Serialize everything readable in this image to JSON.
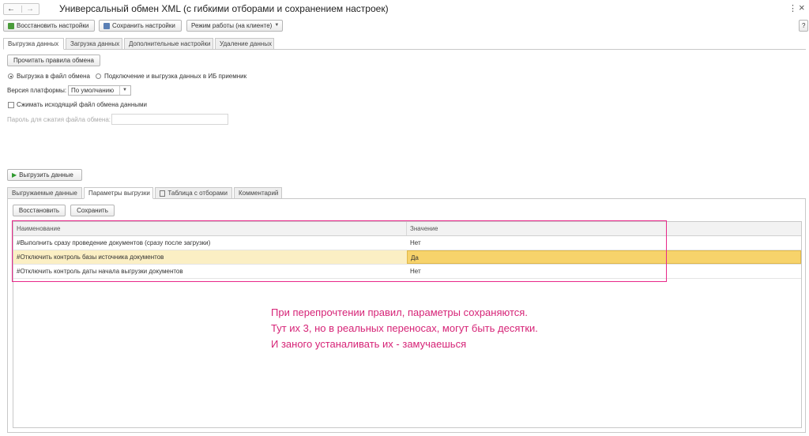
{
  "window": {
    "title": "Универсальный обмен XML (с гибкими отборами и сохранением настроек)",
    "help_label": "?",
    "more_glyph": "⋮",
    "close_glyph": "×"
  },
  "nav": {
    "back_glyph": "←",
    "forward_glyph": "→"
  },
  "toolbar": {
    "restore_settings": "Восстановить настройки",
    "save_settings": "Сохранить настройки",
    "mode": "Режим работы (на клиенте)"
  },
  "main_tabs": [
    "Выгрузка данных",
    "Загрузка данных",
    "Дополнительные настройки",
    "Удаление данных"
  ],
  "export": {
    "read_rules_button": "Прочитать правила обмена",
    "radio_file": "Выгрузка в файл обмена",
    "radio_connect": "Подключение и выгрузка данных в ИБ приемник",
    "platform_label": "Версия платформы:",
    "platform_value": "По умолчанию",
    "compress_label": "Сжимать исходящий файл обмена данными",
    "password_label": "Пароль для сжатия файла обмена:",
    "password_value": "",
    "run_button": "Выгрузить данные"
  },
  "sub_tabs": [
    "Выгружаемые данные",
    "Параметры выгрузки",
    "Таблица с отборами",
    "Комментарий"
  ],
  "params": {
    "restore_button": "Восстановить",
    "save_button": "Сохранить",
    "columns": {
      "name": "Наименование",
      "value": "Значение"
    },
    "rows": [
      {
        "name": "#Выполнить сразу проведение документов (сразу после загрузки)",
        "value": "Нет"
      },
      {
        "name": "#Отключить контроль базы источника документов",
        "value": "Да"
      },
      {
        "name": "#Отключить контроль даты начала выгрузки документов",
        "value": "Нет"
      }
    ]
  },
  "annotation": {
    "line1": "При перепрочтении правил, параметры сохраняются.",
    "line2": "Тут их 3, но в реальных переносах, могут быть десятки.",
    "line3": "И заного устаналивать их - замучаешься"
  },
  "colors": {
    "highlight_border": "#e8288a",
    "selected_row": "#fbefc4",
    "selected_cell": "#f7d36b",
    "annotation_text": "#d62477"
  }
}
